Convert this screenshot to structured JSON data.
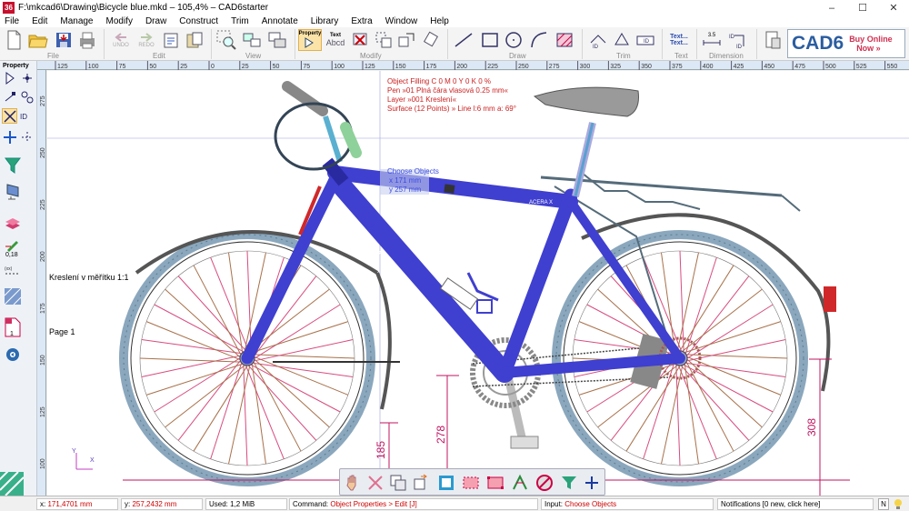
{
  "window": {
    "title": "F:\\mkcad6\\Drawing\\Bicycle blue.mkd – 105,4% – CAD6starter",
    "icon_label": "36",
    "minimize": "–",
    "maximize": "☐",
    "close": "✕"
  },
  "menu": [
    "File",
    "Edit",
    "Manage",
    "Modify",
    "Draw",
    "Construct",
    "Trim",
    "Annotate",
    "Library",
    "Extra",
    "Window",
    "Help"
  ],
  "ribbon": {
    "undo_label": "UNDO",
    "redo_label": "REDO",
    "property_label": "Property",
    "text_label": "Text",
    "text_sample": "Abcd",
    "text_tool_label": "Text...",
    "dim_value": "3.5",
    "groups": [
      "File",
      "Edit",
      "View",
      "Modify",
      "Draw",
      "Trim",
      "Text",
      "Dimension"
    ],
    "logo": "CAD6",
    "buy_line1": "Buy Online",
    "buy_line2": "Now »"
  },
  "left_toolbar": {
    "header": "Property",
    "pen_width": "0,18",
    "page_count": "1"
  },
  "rulers": {
    "top": [
      "125",
      "100",
      "75",
      "50",
      "25",
      "0",
      "25",
      "50",
      "75",
      "100",
      "125",
      "150",
      "175",
      "200",
      "225",
      "250",
      "275",
      "300",
      "325",
      "350",
      "375",
      "400",
      "425",
      "450",
      "475",
      "500",
      "525",
      "550",
      "575"
    ],
    "left": [
      "275",
      "250",
      "225",
      "200",
      "175",
      "150",
      "125",
      "100"
    ]
  },
  "canvas": {
    "info_lines": [
      "Object Filling C 0 M 0 Y 0 K 0 %",
      "Pen »01 Plná čára vlasová 0.25 mm«",
      "Layer »001 Kreslení«",
      "Surface (12 Points) » Line l:6 mm a: 69°"
    ],
    "choose_objects": "Choose Objects",
    "coord_x": "x   171 mm",
    "coord_y": "y   257 mm",
    "drawing_label": "Kreslení v měřítku 1:1",
    "page_label": "Page 1",
    "brand_text": "AMULET",
    "acera_text": "ACERA X",
    "dim_185": "185",
    "dim_278": "278",
    "dim_308": "308",
    "axis_x": "X",
    "axis_y": "Y"
  },
  "status": {
    "x_label": "x:",
    "x_value": "171,4701 mm",
    "y_label": "y:",
    "y_value": "257,2432 mm",
    "used": "Used: 1,2 MiB",
    "command_label": "Command:",
    "command_value": "Object Properties > Edit [J]",
    "input_label": "Input:",
    "input_value": "Choose Objects",
    "notifications": "Notifications [0 new, click here]"
  },
  "colors": {
    "frame": "#3f3fd0",
    "tire": "#8aa7bd",
    "spoke_red": "#d84b7f",
    "spoke_brown": "#a8704a",
    "dimension": "#c01560",
    "info_text": "#cc2222",
    "choose_text": "#3a4be0"
  }
}
